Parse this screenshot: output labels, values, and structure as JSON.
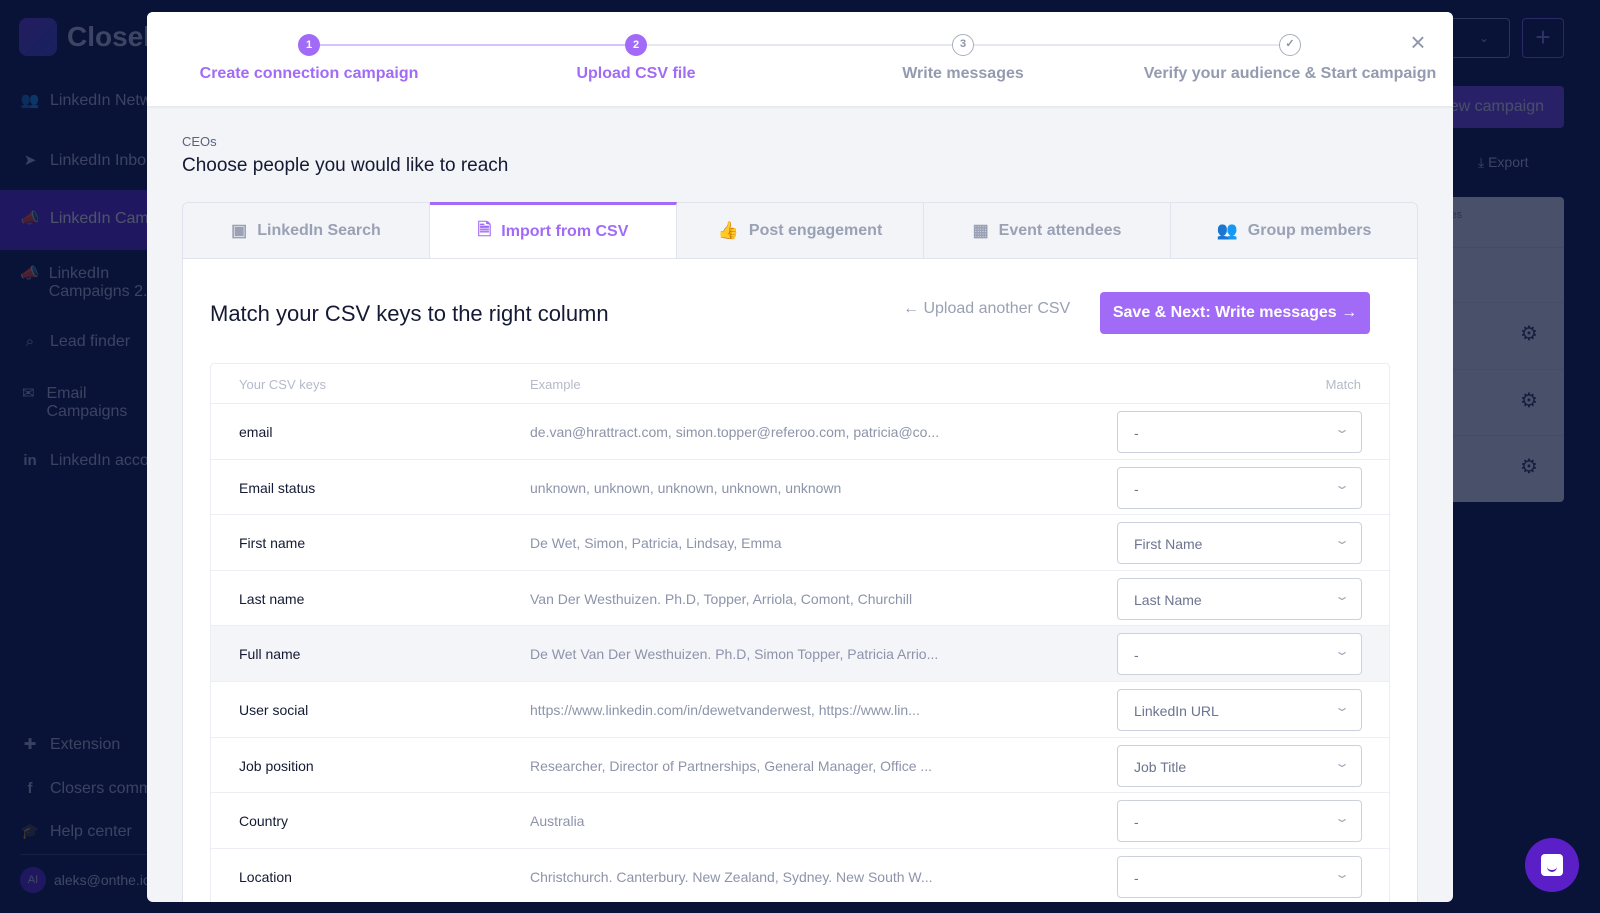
{
  "app": {
    "logo_text": "Closel"
  },
  "sidebar": {
    "items": [
      {
        "label": "LinkedIn Netw",
        "icon": "users-icon"
      },
      {
        "label": "LinkedIn Inbo",
        "icon": "send-icon"
      },
      {
        "label": "LinkedIn Camp",
        "icon": "megaphone-icon",
        "active": true
      },
      {
        "label": "LinkedIn Campaigns 2.",
        "icon": "megaphone-icon"
      },
      {
        "label": "Lead finder",
        "icon": "search-icon"
      },
      {
        "label": "Email Campaigns",
        "icon": "mail-icon"
      },
      {
        "label": "LinkedIn acco",
        "icon": "linkedin-icon"
      },
      {
        "label": "Extension",
        "icon": "puzzle-icon"
      },
      {
        "label": "Closers comm",
        "icon": "facebook-icon"
      },
      {
        "label": "Help center",
        "icon": "graduation-cap-icon"
      }
    ],
    "user": {
      "initials": "AI",
      "email": "aleks@onthe.io"
    }
  },
  "background": {
    "new_campaign_label": "New campaign",
    "export_label": "Export",
    "table_header": "Messages replied",
    "plus_label": "+"
  },
  "modal": {
    "steps": [
      {
        "number": "1",
        "label": "Create connection campaign",
        "state": "done"
      },
      {
        "number": "2",
        "label": "Upload CSV file",
        "state": "done"
      },
      {
        "number": "3",
        "label": "Write messages",
        "state": "todo"
      },
      {
        "number": "✓",
        "label": "Verify your audience & Start campaign",
        "state": "todo"
      }
    ],
    "close_label": "×",
    "breadcrumb": "CEOs",
    "title": "Choose people you would like to reach",
    "tabs": [
      {
        "label": "LinkedIn Search",
        "icon": "linkedin-icon"
      },
      {
        "label": "Import from CSV",
        "icon": "csv-file-icon",
        "active": true
      },
      {
        "label": "Post engagement",
        "icon": "thumbs-up-icon"
      },
      {
        "label": "Event attendees",
        "icon": "calendar-icon"
      },
      {
        "label": "Group members",
        "icon": "users-icon"
      }
    ],
    "panel": {
      "title": "Match your CSV keys to the right column",
      "upload_another": "Upload another CSV",
      "save_next": "Save & Next: Write messages",
      "columns": [
        "Your CSV keys",
        "Example",
        "Match"
      ],
      "rows": [
        {
          "key": "email",
          "example": "de.van@hrattract.com, simon.topper@referoo.com, patricia@co...",
          "match": "-"
        },
        {
          "key": "Email status",
          "example": "unknown, unknown, unknown, unknown, unknown",
          "match": "-"
        },
        {
          "key": "First name",
          "example": "De Wet, Simon, Patricia, Lindsay, Emma",
          "match": "First Name"
        },
        {
          "key": "Last name",
          "example": "Van Der Westhuizen. Ph.D, Topper, Arriola, Comont, Churchill",
          "match": "Last Name"
        },
        {
          "key": "Full name",
          "example": "De Wet Van Der Westhuizen. Ph.D, Simon Topper, Patricia Arrio...",
          "match": "-",
          "highlight": true
        },
        {
          "key": "User social",
          "example": "https://www.linkedin.com/in/dewetvanderwest, https://www.lin...",
          "match": "LinkedIn URL"
        },
        {
          "key": "Job position",
          "example": "Researcher, Director of Partnerships, General Manager, Office ...",
          "match": "Job Title"
        },
        {
          "key": "Country",
          "example": "Australia",
          "match": "-"
        },
        {
          "key": "Location",
          "example": "Christchurch. Canterbury. New Zealand, Sydney. New South W...",
          "match": "-"
        }
      ]
    }
  },
  "colors": {
    "accent": "#a26bf7",
    "sidebar_bg": "#0c1a48",
    "active_nav": "#5b2dd6"
  }
}
